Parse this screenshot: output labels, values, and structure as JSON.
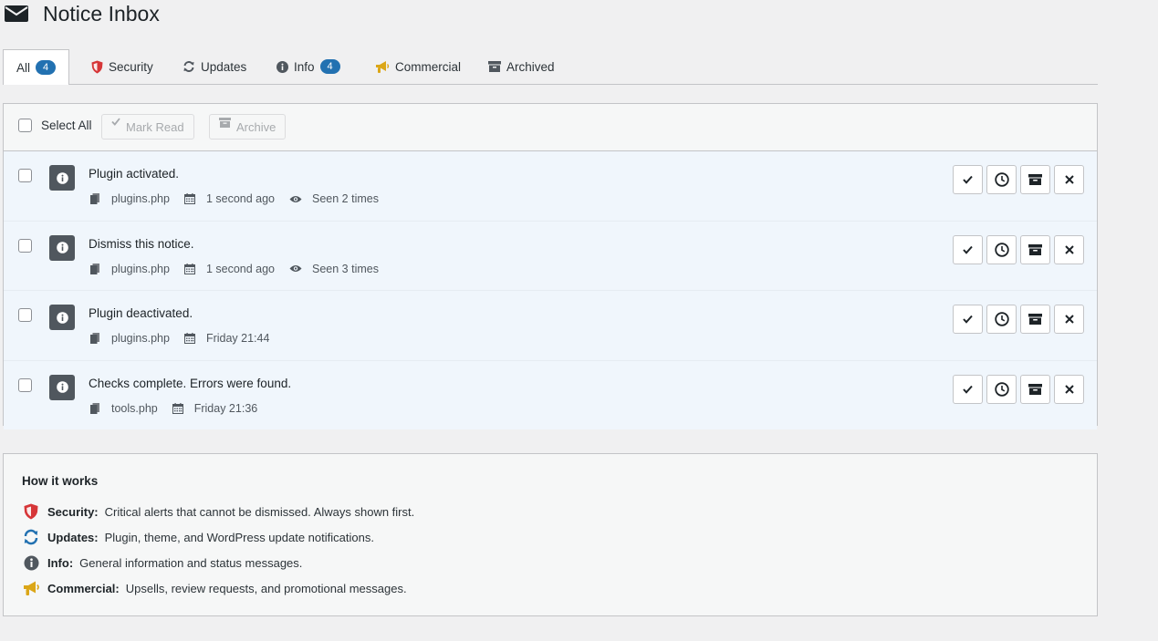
{
  "page": {
    "title": "Notice Inbox"
  },
  "tabs": [
    {
      "label": "All",
      "count": "4"
    },
    {
      "label": "Security"
    },
    {
      "label": "Updates"
    },
    {
      "label": "Info",
      "count": "4"
    },
    {
      "label": "Commercial"
    },
    {
      "label": "Archived"
    }
  ],
  "toolbar": {
    "select_all": "Select All",
    "mark_read": "Mark Read",
    "archive": "Archive"
  },
  "notices": [
    {
      "message": "Plugin activated.",
      "file": "plugins.php",
      "time": "1 second ago",
      "seen": "Seen 2 times"
    },
    {
      "message": "Dismiss this notice.",
      "file": "plugins.php",
      "time": "1 second ago",
      "seen": "Seen 3 times"
    },
    {
      "message": "Plugin deactivated.",
      "file": "plugins.php",
      "time": "Friday 21:44"
    },
    {
      "message": "Checks complete. Errors were found.",
      "file": "tools.php",
      "time": "Friday 21:36"
    }
  ],
  "how_it_works": {
    "title": "How it works",
    "items": [
      {
        "label": "Security:",
        "text": "Critical alerts that cannot be dismissed. Always shown first.",
        "icon": "shield-icon",
        "color": "#d63638"
      },
      {
        "label": "Updates:",
        "text": "Plugin, theme, and WordPress update notifications.",
        "icon": "update-icon",
        "color": "#2271b1"
      },
      {
        "label": "Info:",
        "text": "General information and status messages.",
        "icon": "info-icon",
        "color": "#50575e"
      },
      {
        "label": "Commercial:",
        "text": "Upsells, review requests, and promotional messages.",
        "icon": "megaphone-icon",
        "color": "#dba617"
      }
    ]
  },
  "colors": {
    "accent": "#2271b1",
    "security": "#d63638",
    "commercial": "#dba617"
  }
}
